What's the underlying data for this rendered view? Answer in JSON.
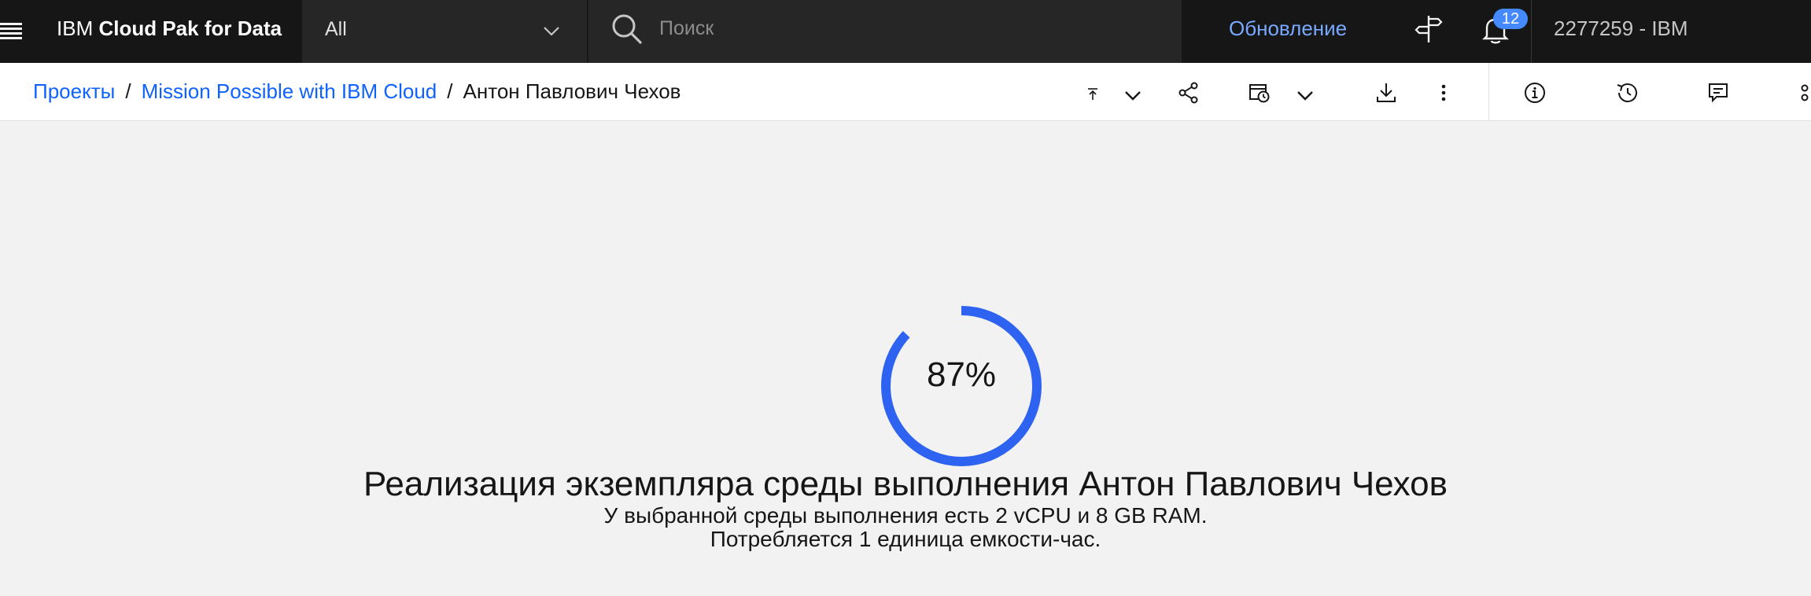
{
  "header": {
    "brand_prefix": "IBM",
    "brand_name": "Cloud Pak for Data",
    "scope_selected": "All",
    "search_placeholder": "Поиск",
    "update_label": "Обновление",
    "notification_count": "12",
    "account": "2277259 - IBM"
  },
  "breadcrumb": {
    "items": [
      "Проекты",
      "Mission Possible with IBM Cloud"
    ],
    "separator": "/",
    "current": "Антон Павлович Чехов"
  },
  "toolbar": {
    "icons": [
      "upload-icon",
      "chevron-down-icon",
      "share-icon",
      "schedule-icon",
      "chevron-down-icon",
      "download-icon",
      "overflow-menu-icon",
      "info-icon",
      "history-icon",
      "comment-icon",
      "more-icon"
    ]
  },
  "progress": {
    "percent": 87,
    "percent_label": "87%",
    "title": "Реализация экземпляра среды выполнения Антон Павлович Чехов",
    "line1": "У выбранной среды выполнения есть 2 vCPU и 8 GB RAM.",
    "line2": "Потребляется 1 единица емкости-час."
  },
  "colors": {
    "header_bg": "#161616",
    "accent": "#0f62fe",
    "progress": "#2d63f0",
    "background": "#f2f2f2"
  }
}
